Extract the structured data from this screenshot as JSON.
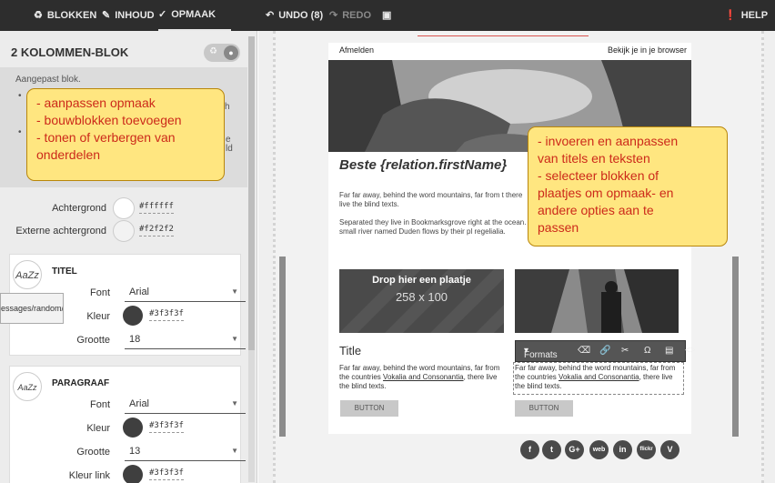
{
  "topbar": {
    "tabs": [
      {
        "icon": "blocks-icon",
        "label": "BLOKKEN"
      },
      {
        "icon": "pencil-icon",
        "label": "INHOUD"
      },
      {
        "icon": "brush-icon",
        "label": "OPMAAK"
      }
    ],
    "undo": "UNDO (8)",
    "redo": "REDO",
    "help": "HELP"
  },
  "panel": {
    "title": "2 KOLOMMEN-BLOK",
    "description": "Aangepast blok.",
    "background": {
      "label": "Achtergrond",
      "value": "#ffffff"
    },
    "outer_background": {
      "label": "Externe achtergrond",
      "value": "#f2f2f2"
    },
    "title_section": {
      "icon_text": "AaZz",
      "name": "TITEL",
      "font_label": "Font",
      "font_value": "Arial",
      "color_label": "Kleur",
      "color_value": "#3f3f3f",
      "size_label": "Grootte",
      "size_value": "18"
    },
    "paragraph_section": {
      "icon_text": "AaZz",
      "name": "PARAGRAAF",
      "font_label": "Font",
      "font_value": "Arial",
      "color_label": "Kleur",
      "color_value": "#3f3f3f",
      "size_label": "Grootte",
      "size_value": "13",
      "link_color_label": "Kleur link",
      "link_color_value": "#3f3f3f"
    },
    "tooltip": "essages/random/"
  },
  "callouts": {
    "left": [
      "- aanpassen opmaak",
      "- bouwblokken toevoegen",
      "- tonen of verbergen van",
      "  onderdelen"
    ],
    "right": [
      "- invoeren en aanpassen",
      "  van titels en teksten",
      "- selecteer blokken of",
      "  plaatjes om opmaak- en",
      "  andere opties aan te",
      "  passen"
    ]
  },
  "email": {
    "unsubscribe": "Afmelden",
    "view_in_browser": "Bekijk je in je browser",
    "greeting": "Beste {relation.firstName}",
    "para1": "Far far away, behind the word mountains, far from t there live the blind texts.",
    "para2": "Separated they live in Bookmarksgrove right at the ocean. A small river named Duden flows by their pl regelialia.",
    "drop_title": "Drop hier een plaatje",
    "drop_size": "258 x 100",
    "col_title": "Title",
    "col_text_pre": "Far far away, behind the word mountains, far from the countries",
    "col_text_link": "Vokalia and Consonantia",
    "col_text_post": ", there live the blind texts.",
    "button": "BUTTON",
    "toolbar_formats": "Formats",
    "social": [
      "f",
      "t",
      "G+",
      "web",
      "in",
      "flickr",
      "V"
    ]
  },
  "colors": {
    "topbar": "#2d2d2d",
    "callout_bg": "#ffe680",
    "callout_text": "#cc2a1a",
    "swatch_dark": "#3f3f3f"
  }
}
